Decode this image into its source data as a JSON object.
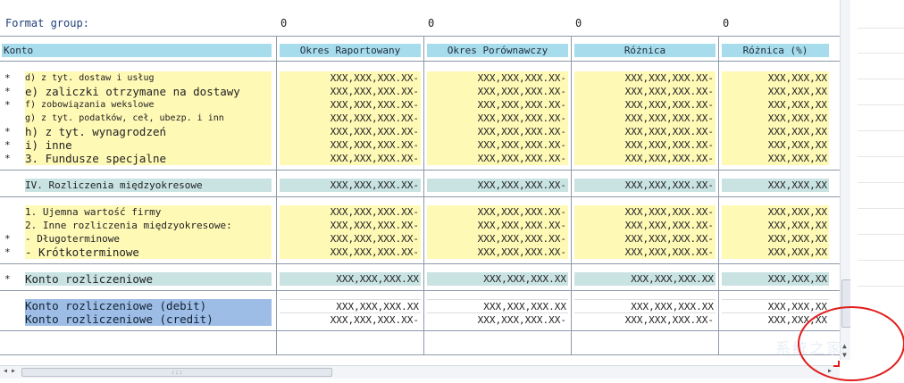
{
  "format_group": {
    "label": "Format group:",
    "values": [
      "0",
      "0",
      "0",
      "0"
    ]
  },
  "headers": {
    "konto": "Konto",
    "col1": "Okres Raportowany",
    "col2": "Okres Porównawczy",
    "col3": "Różnica",
    "col4": "Różnica (%)"
  },
  "rows": [
    {
      "star": "*",
      "label": "d) z tyt. dostaw i usług",
      "v": [
        "XXX,XXX,XXX.XX-",
        "XXX,XXX,XXX.XX-",
        "XXX,XXX,XXX.XX-",
        "XXX,XXX,XX"
      ]
    },
    {
      "star": "*",
      "label": "e) zaliczki otrzymane na dostawy",
      "v": [
        "XXX,XXX,XXX.XX-",
        "XXX,XXX,XXX.XX-",
        "XXX,XXX,XXX.XX-",
        "XXX,XXX,XX"
      ]
    },
    {
      "star": "*",
      "label": "f) zobowiązania wekslowe",
      "v": [
        "XXX,XXX,XXX.XX-",
        "XXX,XXX,XXX.XX-",
        "XXX,XXX,XXX.XX-",
        "XXX,XXX,XX"
      ]
    },
    {
      "star": "",
      "label": "g) z tyt. podatków, ceł, ubezp. i inn",
      "v": [
        "XXX,XXX,XXX.XX-",
        "XXX,XXX,XXX.XX-",
        "XXX,XXX,XXX.XX-",
        "XXX,XXX,XX"
      ]
    },
    {
      "star": "*",
      "label": "h) z tyt. wynagrodzeń",
      "v": [
        "XXX,XXX,XXX.XX-",
        "XXX,XXX,XXX.XX-",
        "XXX,XXX,XXX.XX-",
        "XXX,XXX,XX"
      ]
    },
    {
      "star": "*",
      "label": "i) inne",
      "v": [
        "XXX,XXX,XXX.XX-",
        "XXX,XXX,XXX.XX-",
        "XXX,XXX,XXX.XX-",
        "XXX,XXX,XX"
      ]
    },
    {
      "star": "*",
      "label": "3. Fundusze specjalne",
      "v": [
        "XXX,XXX,XXX.XX-",
        "XXX,XXX,XXX.XX-",
        "XXX,XXX,XXX.XX-",
        "XXX,XXX,XX"
      ]
    },
    {
      "star": "",
      "label": "IV. Rozliczenia międzyokresowe",
      "v": [
        "XXX,XXX,XXX.XX-",
        "XXX,XXX,XXX.XX-",
        "XXX,XXX,XXX.XX-",
        "XXX,XXX,XX"
      ]
    },
    {
      "star": "",
      "label": "1.  Ujemna wartość firmy",
      "v": [
        "XXX,XXX,XXX.XX-",
        "XXX,XXX,XXX.XX-",
        "XXX,XXX,XXX.XX-",
        "XXX,XXX,XX"
      ]
    },
    {
      "star": "",
      "label": "2.  Inne rozliczenia międzyokresowe:",
      "v": [
        "XXX,XXX,XXX.XX-",
        "XXX,XXX,XXX.XX-",
        "XXX,XXX,XXX.XX-",
        "XXX,XXX,XX"
      ]
    },
    {
      "star": "*",
      "label": "- Długoterminowe",
      "v": [
        "XXX,XXX,XXX.XX-",
        "XXX,XXX,XXX.XX-",
        "XXX,XXX,XXX.XX-",
        "XXX,XXX,XX"
      ]
    },
    {
      "star": "*",
      "label": "- Krótkoterminowe",
      "v": [
        "XXX,XXX,XXX.XX-",
        "XXX,XXX,XXX.XX-",
        "XXX,XXX,XXX.XX-",
        "XXX,XXX,XX"
      ]
    },
    {
      "star": "*",
      "label": "Konto rozliczeniowe",
      "v": [
        "XXX,XXX,XXX.XX",
        "XXX,XXX,XXX.XX",
        "XXX,XXX,XXX.XX",
        "XXX,XXX,XX"
      ]
    },
    {
      "star": "",
      "label": "Konto rozliczeniowe (debit)",
      "v": [
        "XXX,XXX,XXX.XX",
        "XXX,XXX,XXX.XX",
        "XXX,XXX,XXX.XX",
        "XXX,XXX,XX"
      ]
    },
    {
      "star": "",
      "label": "Konto rozliczeniowe (credit)",
      "v": [
        "XXX,XXX,XXX.XX-",
        "XXX,XXX,XXX.XX-",
        "XXX,XXX,XXX.XX-",
        "XXX,XXX,XX"
      ]
    }
  ],
  "scroll": {
    "up": "▲",
    "down": "▼",
    "left": "◂",
    "right": "▸",
    "grip": ":::"
  },
  "watermark": "系统之家",
  "colors": {
    "header": "#a7dcec",
    "yellow": "#fff9b6",
    "teal": "#c9e3e3",
    "blue": "#9dbde6",
    "annotation": "#e01d1d"
  }
}
